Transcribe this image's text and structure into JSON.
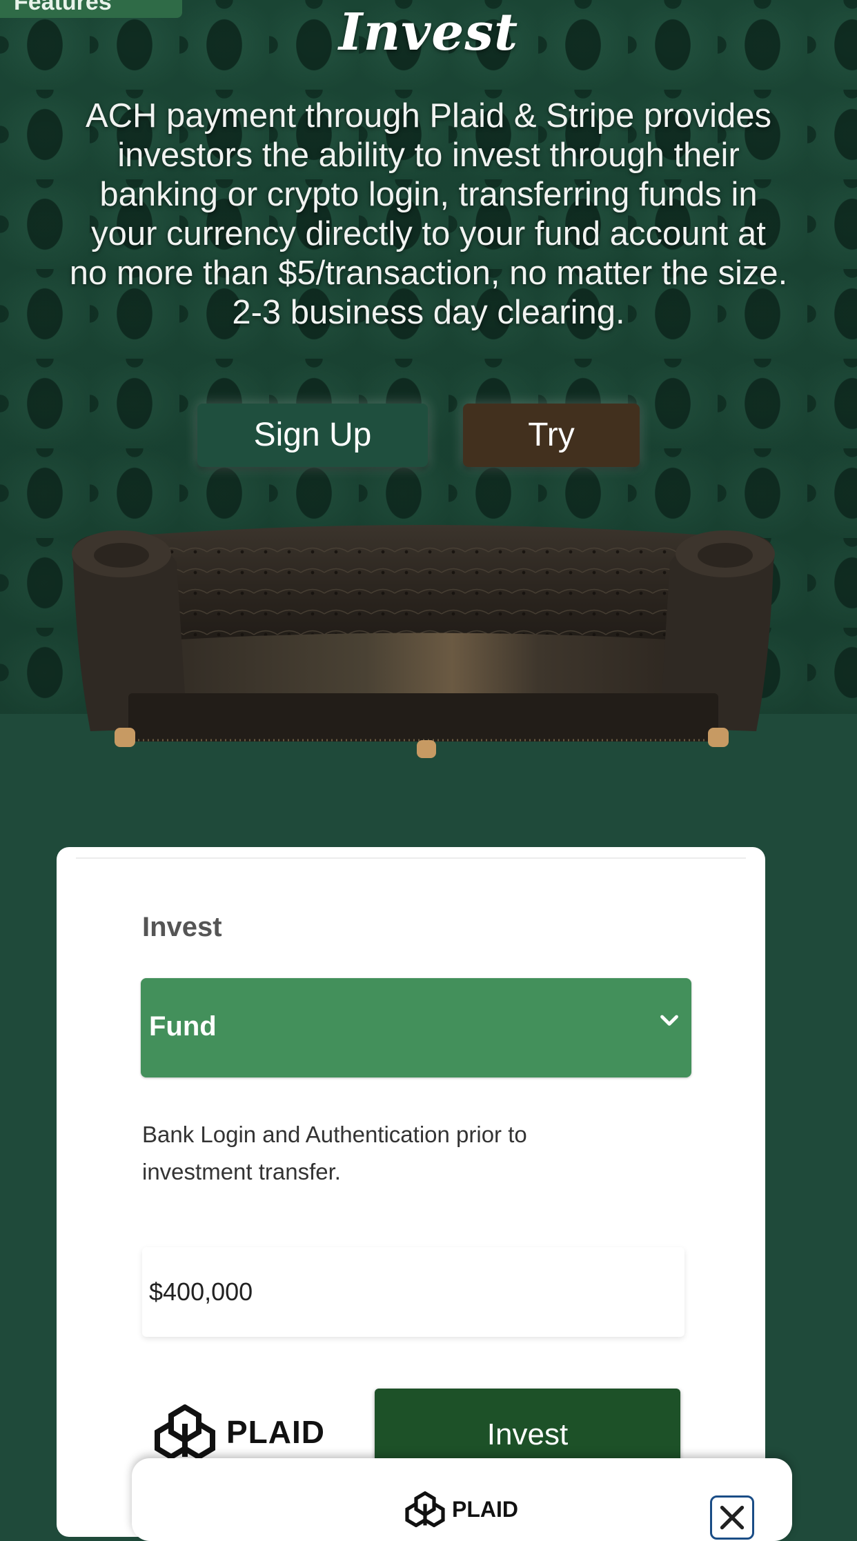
{
  "hero": {
    "features_label": "Features",
    "title": "Invest",
    "description": "ACH payment through Plaid & Stripe provides investors the ability to invest through their banking or crypto login, transferring  funds in your currency directly to your fund account at no more than $5/transaction, no matter the size. 2-3 business day clearing.",
    "signup_label": "Sign Up",
    "try_label": "Try"
  },
  "form": {
    "label": "Invest",
    "select_value": "Fund",
    "help_text": "Bank Login and Authentication prior to investment transfer.",
    "amount": "$400,000",
    "plaid_label": "PLAID",
    "invest_button": "Invest"
  },
  "modal": {
    "plaid_label": "PLAID"
  },
  "colors": {
    "page_bg": "#1f4a3a",
    "select_bg": "#43905b",
    "invest_button_bg": "#1d5128",
    "signup_bg": "#1f4f3e",
    "try_bg": "#42301e"
  },
  "icons": [
    "chevron-down-icon",
    "plaid-logo-icon",
    "close-icon"
  ]
}
